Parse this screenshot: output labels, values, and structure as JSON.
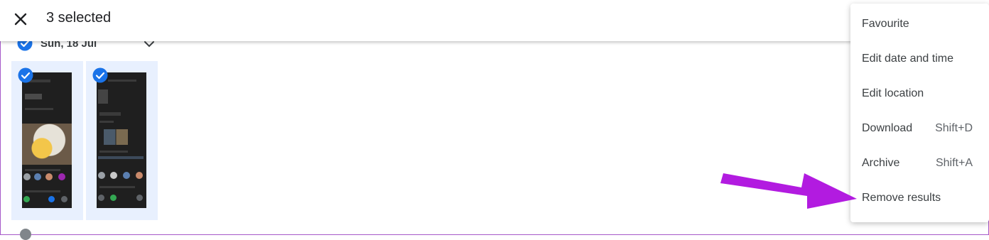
{
  "topbar": {
    "close_icon": "close-icon",
    "selected_text": "3 selected"
  },
  "date_group": {
    "label": "Sun, 18 Jul",
    "check_icon": "check-circle-icon",
    "chevron_icon": "chevron-down-icon"
  },
  "photos": [
    {
      "name": "photo-1",
      "selected": true
    },
    {
      "name": "photo-2",
      "selected": true
    }
  ],
  "menu": {
    "items": [
      {
        "label": "Favourite",
        "shortcut": ""
      },
      {
        "label": "Edit date and time",
        "shortcut": ""
      },
      {
        "label": "Edit location",
        "shortcut": ""
      },
      {
        "label": "Download",
        "shortcut": "Shift+D"
      },
      {
        "label": "Archive",
        "shortcut": "Shift+A"
      },
      {
        "label": "Remove results",
        "shortcut": ""
      }
    ]
  },
  "annotation": {
    "icon": "pointer-arrow-icon",
    "color": "#b21be0"
  },
  "colors": {
    "accent": "#1a73e8",
    "frame": "#a659c9",
    "tile_bg": "#e8f0fe"
  }
}
